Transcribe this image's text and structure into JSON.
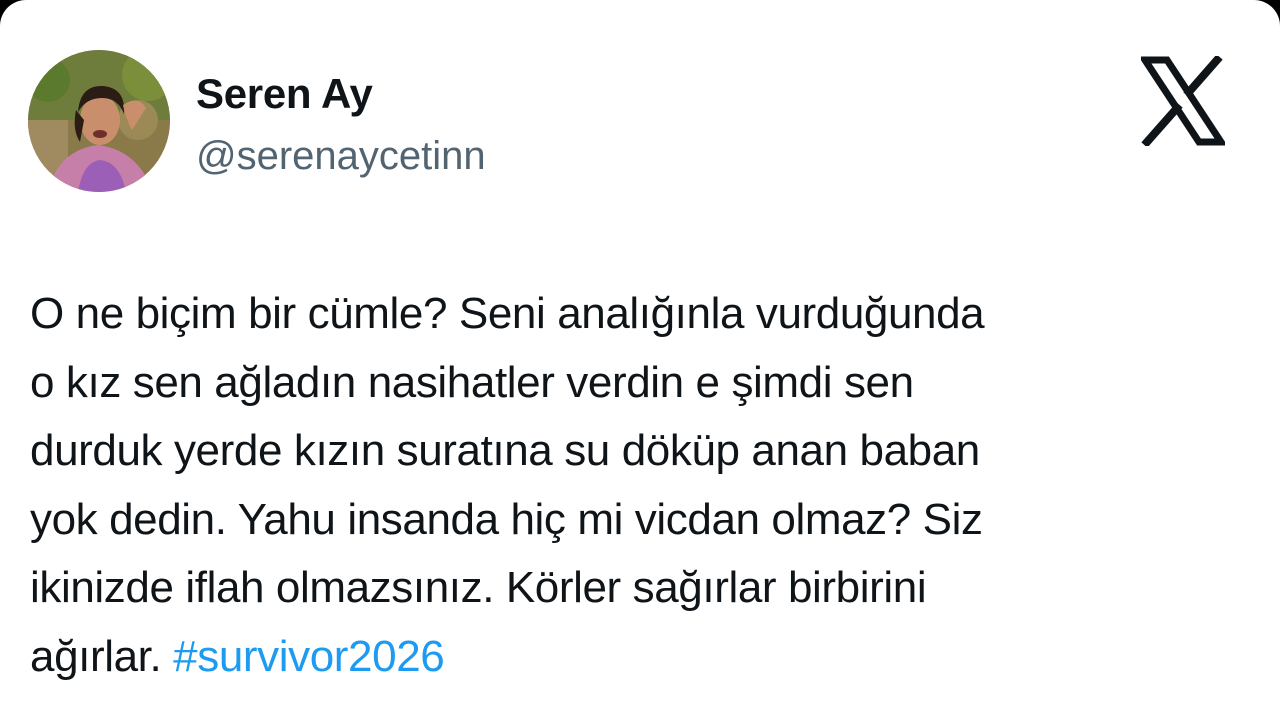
{
  "author": {
    "display_name": "Seren Ay",
    "handle": "@serenaycetinn",
    "avatar_icon": "profile-photo"
  },
  "platform": {
    "logo_icon": "x-logo-icon",
    "accent_color": "#1d9bf0"
  },
  "tweet": {
    "lines": [
      "O ne biçim bir cümle? Seni analığınla vurduğunda",
      "o kız sen ağladın nasihatler verdin e şimdi sen",
      "durduk yerde kızın suratına su döküp anan baban",
      "yok dedin. Yahu insanda hiç mi vicdan olmaz? Siz",
      "ikinizde iflah olmazsınız. Körler sağırlar birbirini",
      "ağırlar."
    ],
    "hashtag": "#survivor2026"
  }
}
